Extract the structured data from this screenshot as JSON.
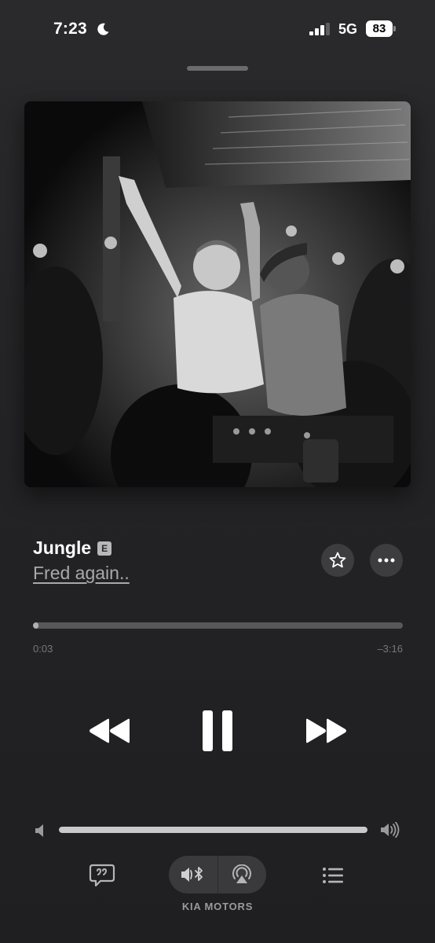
{
  "status_bar": {
    "time": "7:23",
    "network": "5G",
    "battery": "83"
  },
  "track": {
    "title": "Jungle",
    "explicit_badge": "E",
    "artist": "Fred again.."
  },
  "progress": {
    "elapsed": "0:03",
    "remaining": "–3:16",
    "fraction": 0.015
  },
  "volume": {
    "fraction": 1.0
  },
  "output": {
    "route_label": "KIA MOTORS"
  },
  "icons": {
    "moon": "moon-icon",
    "signal": "signal-icon",
    "favorite": "star-icon",
    "more": "ellipsis-icon",
    "rewind": "rewind-icon",
    "pause": "pause-icon",
    "forward": "fast-forward-icon",
    "lyrics": "lyrics-bubble-icon",
    "bluetooth_speaker": "bluetooth-speaker-icon",
    "airplay": "airplay-audio-icon",
    "queue": "queue-list-icon"
  },
  "colors": {
    "background": "#242426",
    "accent": "#ffffff",
    "secondary_text": "#a9a9ad"
  }
}
